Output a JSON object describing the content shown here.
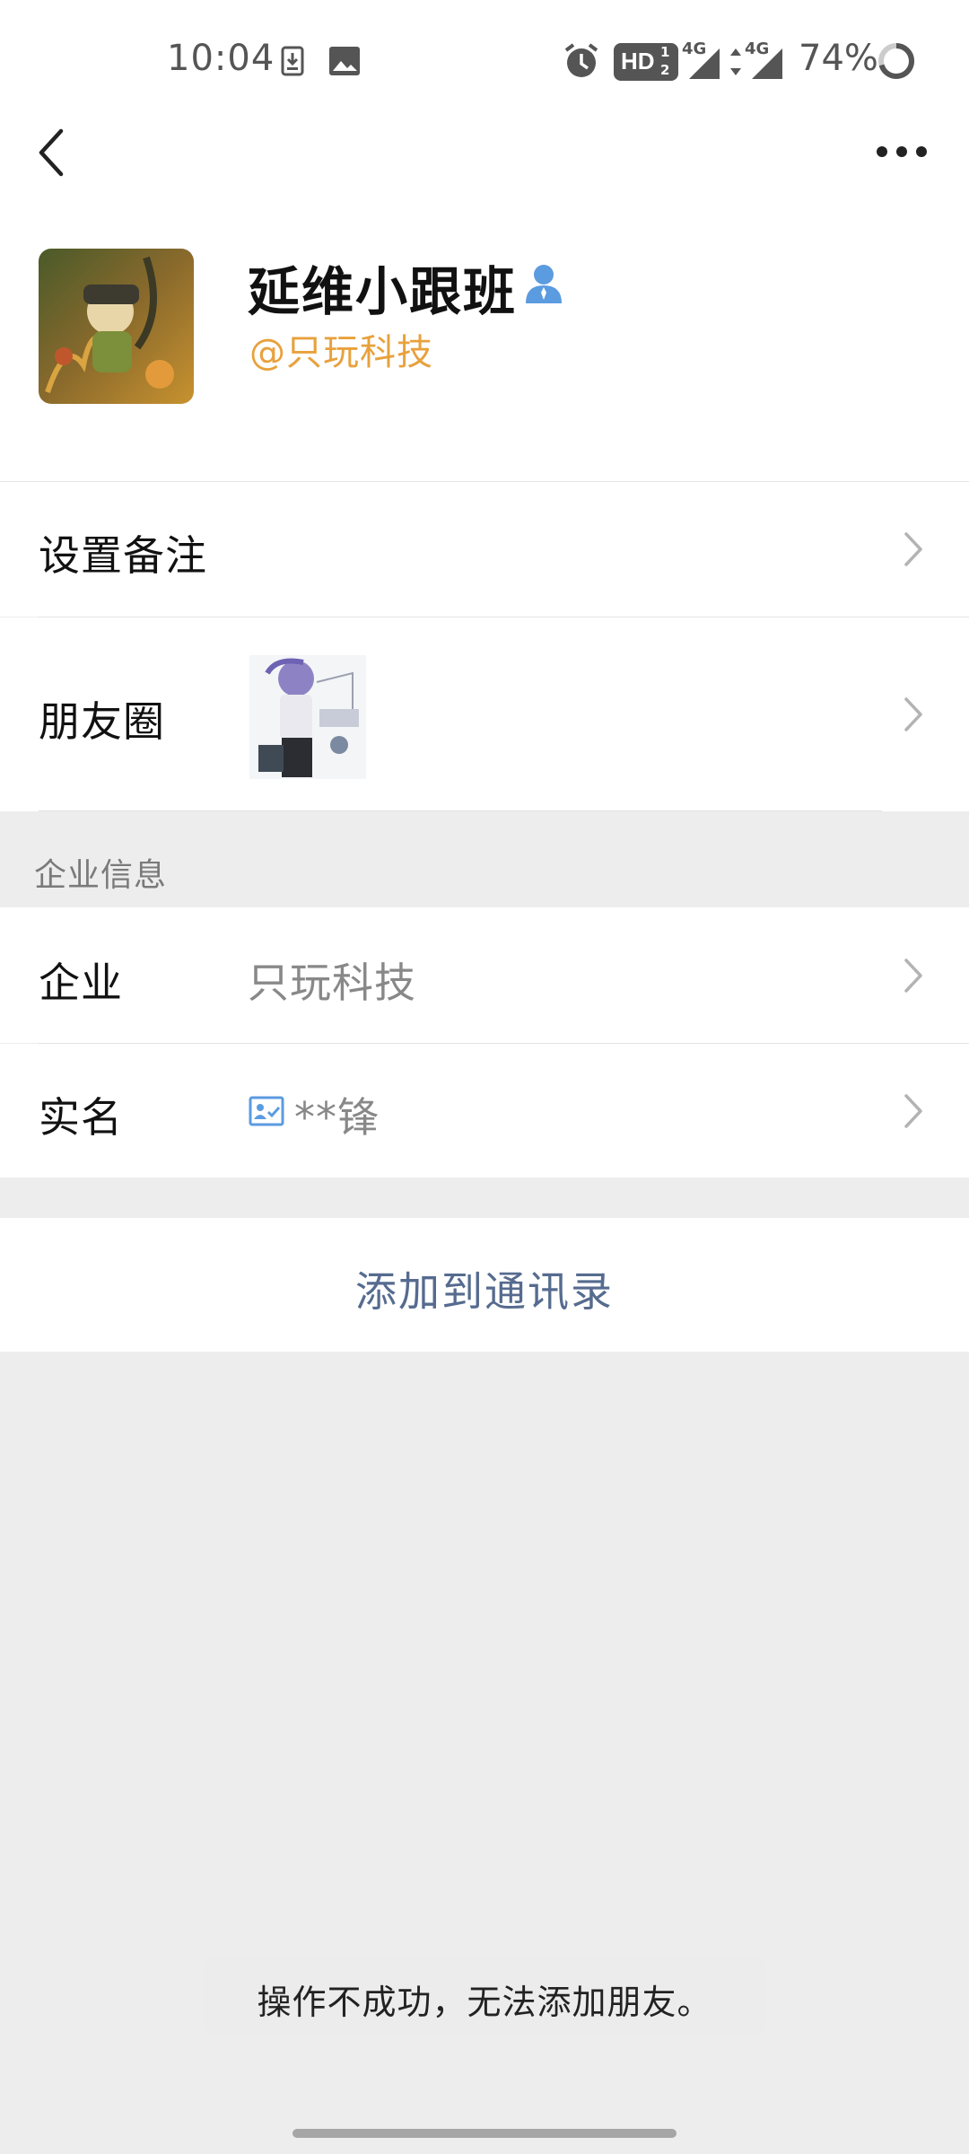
{
  "status_bar": {
    "time": "10:04",
    "battery_percent": "74%",
    "icons": [
      "download-icon",
      "image-icon",
      "alarm-icon",
      "hd-badge-icon",
      "signal-4g-icon",
      "signal-4g-icon",
      "battery-ring-icon"
    ],
    "hd_label": "HD",
    "network": "4G"
  },
  "nav": {
    "back_icon": "chevron-left-icon",
    "more_icon": "more-dots-icon"
  },
  "profile": {
    "name": "延维小跟班",
    "corp_tag": "@只玩科技",
    "name_icon": "person-icon"
  },
  "rows": {
    "remark_label": "设置备注",
    "moments_label": "朋友圈"
  },
  "enterprise_section": {
    "title": "企业信息",
    "company_label": "企业",
    "company_value": "只玩科技",
    "realname_label": "实名",
    "realname_value": "**锋",
    "realname_icon": "id-card-icon"
  },
  "actions": {
    "add_contact": "添加到通讯录"
  },
  "toast": {
    "message": "操作不成功，无法添加朋友。"
  },
  "colors": {
    "accent_orange": "#e8a13c",
    "link_blue": "#566b8f",
    "background_gray": "#ededed"
  }
}
